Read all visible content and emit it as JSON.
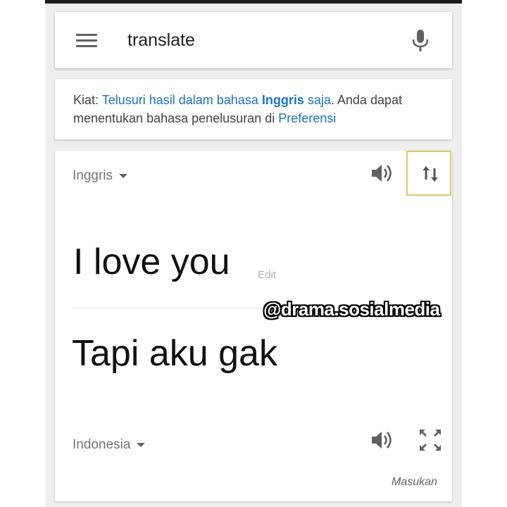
{
  "search": {
    "query": "translate",
    "menu_icon": "hamburger-menu-icon",
    "mic_icon": "microphone-icon"
  },
  "tip": {
    "prefix": "Kiat: ",
    "link1": "Telusuri hasil dalam bahasa ",
    "link1_bold": "Inggris",
    "link1_suffix": " saja",
    "middle": ". Anda dapat menentukan bahasa penelusuran di ",
    "link2": "Preferensi"
  },
  "translator": {
    "source_lang": "Inggris",
    "target_lang": "Indonesia",
    "source_text": "I love you",
    "edit_label": "Edit",
    "target_text": "Tapi aku gak",
    "feedback_label": "Masukan",
    "icons": {
      "speaker": "speaker-icon",
      "swap": "swap-languages-icon",
      "expand": "fullscreen-expand-icon"
    }
  },
  "watermark": "@drama.sosialmedia",
  "colors": {
    "link": "#1a73c8",
    "background": "#eeeeee",
    "swap_border": "#e0c765"
  }
}
